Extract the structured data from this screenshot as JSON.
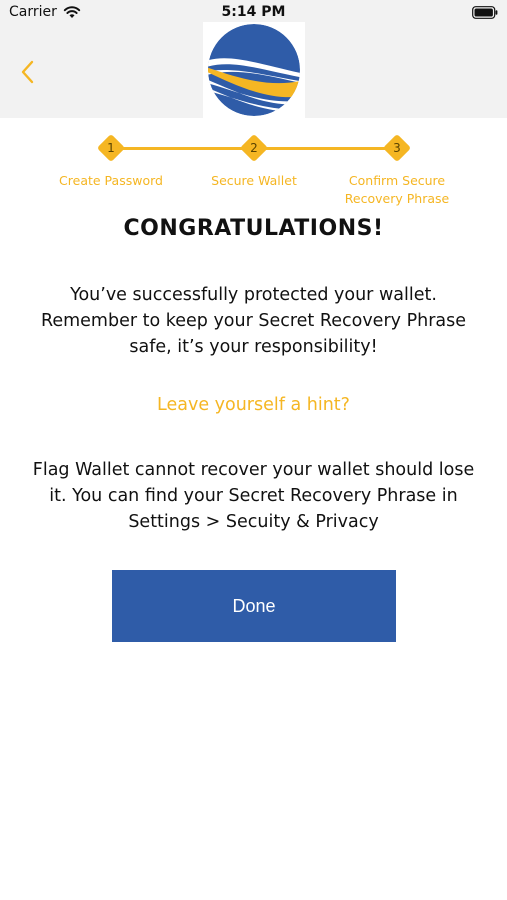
{
  "status_bar": {
    "carrier": "Carrier",
    "time": "5:14 PM"
  },
  "steps": [
    {
      "number": "1",
      "label": "Create Password"
    },
    {
      "number": "2",
      "label": "Secure Wallet"
    },
    {
      "number": "3",
      "label": "Confirm Secure Recovery Phrase"
    }
  ],
  "content": {
    "title": "CONGRATULATIONS!",
    "message": "You’ve successfully protected your wallet. Remember to keep your Secret Recovery Phrase safe, it’s your responsibility!",
    "hint_link": "Leave yourself a hint?",
    "info": "Flag Wallet cannot recover your wallet should lose it. You can find your Secret Recovery Phrase in Settings > Secuity & Privacy",
    "done_button": "Done"
  },
  "colors": {
    "accent": "#f5b623",
    "primary": "#2f5ca8",
    "header_bg": "#f2f2f2"
  }
}
